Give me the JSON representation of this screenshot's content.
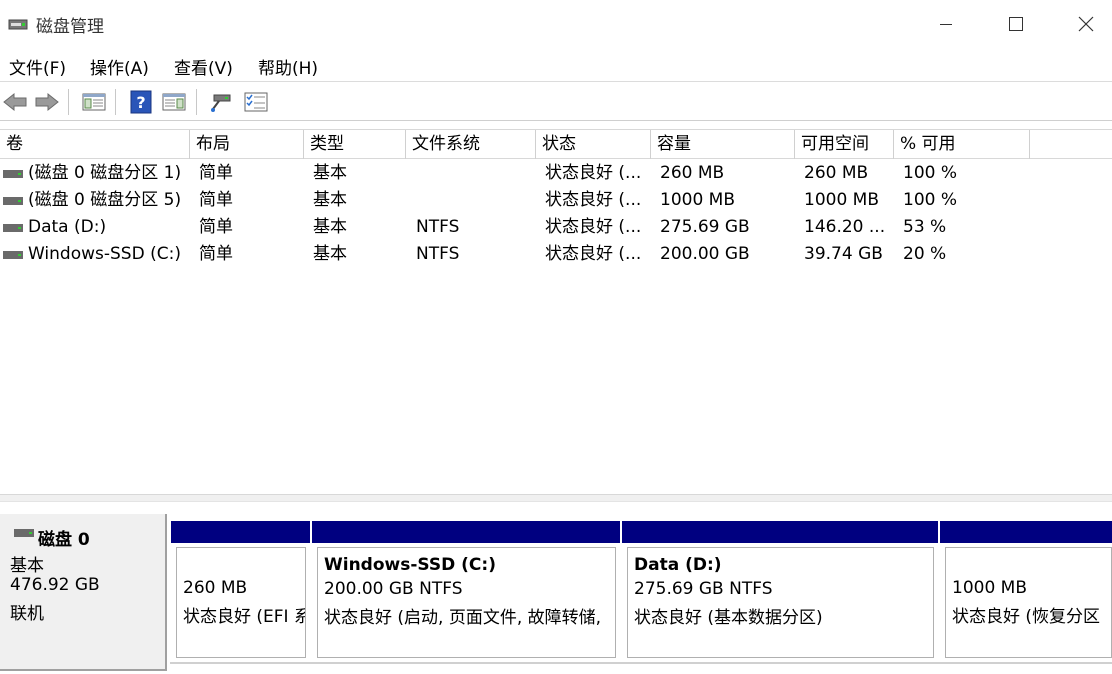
{
  "window": {
    "title": "磁盘管理",
    "minimize_glyph": "—",
    "close_glyph": "✕"
  },
  "menu": [
    "文件(F)",
    "操作(A)",
    "查看(V)",
    "帮助(H)"
  ],
  "toolbar": {
    "icons": [
      "back-icon",
      "forward-icon",
      "show-hide-console-tree-icon",
      "help-icon",
      "properties-icon",
      "connect-drive-icon",
      "checklist-icon"
    ]
  },
  "volume_list": {
    "columns": [
      "卷",
      "布局",
      "类型",
      "文件系统",
      "状态",
      "容量",
      "可用空间",
      "% 可用"
    ],
    "rows": [
      {
        "volume": "(磁盘 0 磁盘分区 1)",
        "layout": "简单",
        "type": "基本",
        "fs": "",
        "status": "状态良好 (...",
        "capacity": "260 MB",
        "free": "260 MB",
        "pct": "100 %"
      },
      {
        "volume": "(磁盘 0 磁盘分区 5)",
        "layout": "简单",
        "type": "基本",
        "fs": "",
        "status": "状态良好 (...",
        "capacity": "1000 MB",
        "free": "1000 MB",
        "pct": "100 %"
      },
      {
        "volume": "Data (D:)",
        "layout": "简单",
        "type": "基本",
        "fs": "NTFS",
        "status": "状态良好 (...",
        "capacity": "275.69 GB",
        "free": "146.20 ...",
        "pct": "53 %"
      },
      {
        "volume": "Windows-SSD (C:)",
        "layout": "简单",
        "type": "基本",
        "fs": "NTFS",
        "status": "状态良好 (...",
        "capacity": "200.00 GB",
        "free": "39.74 GB",
        "pct": "20 %"
      }
    ]
  },
  "disk": {
    "name": "磁盘 0",
    "type": "基本",
    "size": "476.92 GB",
    "state": "联机",
    "partitions": [
      {
        "title": "",
        "size": "260 MB",
        "status": "状态良好 (EFI 系"
      },
      {
        "title": "Windows-SSD  (C:)",
        "size": "200.00 GB NTFS",
        "status": "状态良好 (启动, 页面文件, 故障转储,"
      },
      {
        "title": "Data  (D:)",
        "size": "275.69 GB NTFS",
        "status": "状态良好 (基本数据分区)"
      },
      {
        "title": "",
        "size": "1000 MB",
        "status": "状态良好 (恢复分区"
      }
    ]
  },
  "colors": {
    "partition_bar": "#000080",
    "disk_panel": "#f0f0f0"
  }
}
